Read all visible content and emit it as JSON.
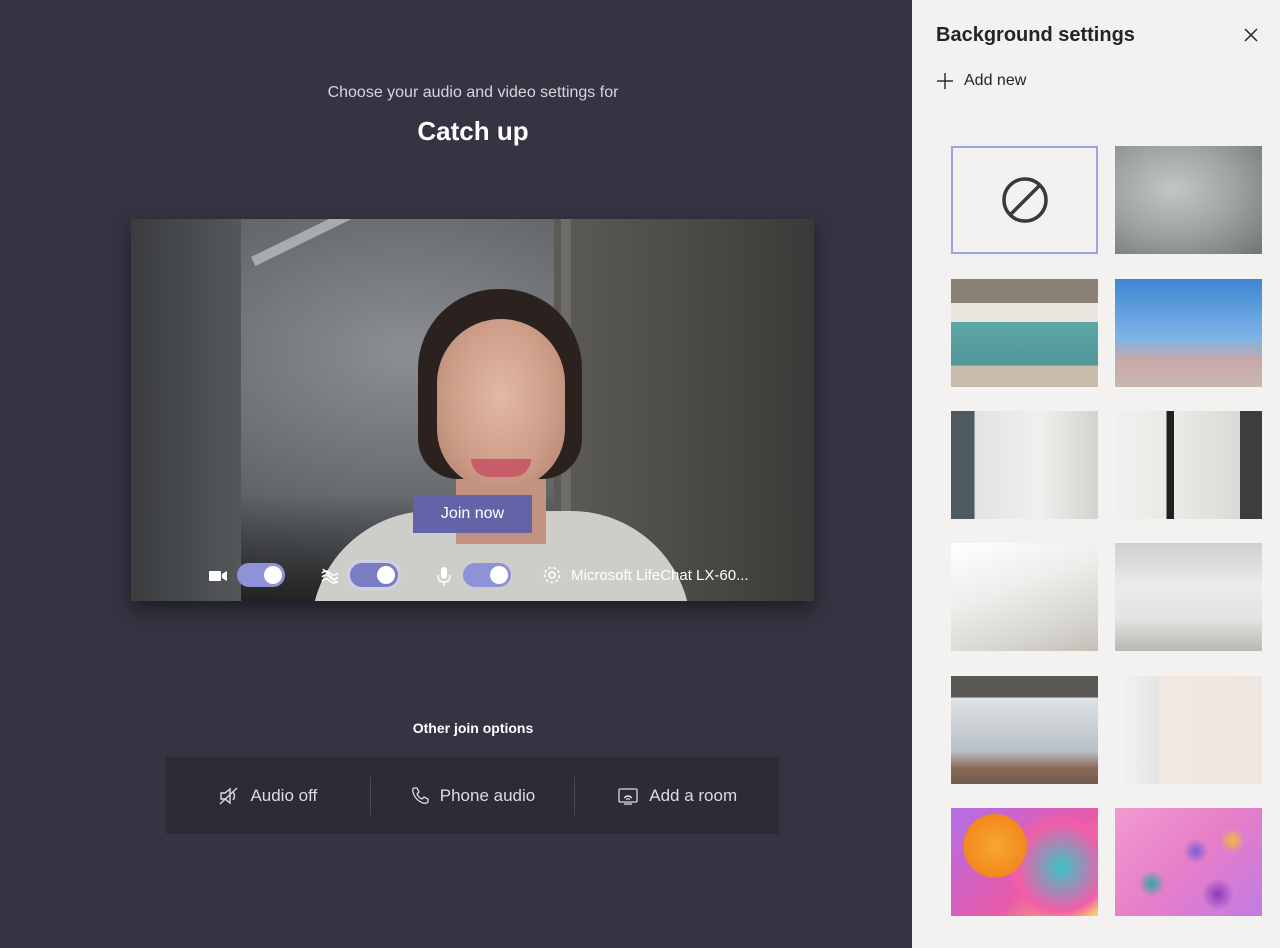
{
  "header": {
    "subtitle": "Choose your audio and video settings for",
    "meeting_title": "Catch up"
  },
  "preview": {
    "join_label": "Join now",
    "camera_on": true,
    "blur_on": true,
    "mic_on": true,
    "device_name": "Microsoft LifeChat LX-60..."
  },
  "other_join": {
    "label": "Other join options",
    "options": [
      {
        "label": "Audio off",
        "icon": "speaker-off-icon"
      },
      {
        "label": "Phone audio",
        "icon": "phone-icon"
      },
      {
        "label": "Add a room",
        "icon": "room-cast-icon"
      }
    ]
  },
  "panel": {
    "title": "Background settings",
    "add_new_label": "Add new",
    "backgrounds": [
      {
        "name": "none",
        "selected": true
      },
      {
        "name": "blur"
      },
      {
        "name": "office"
      },
      {
        "name": "beach"
      },
      {
        "name": "room-1"
      },
      {
        "name": "room-2"
      },
      {
        "name": "room-3"
      },
      {
        "name": "room-4"
      },
      {
        "name": "loft"
      },
      {
        "name": "room-5"
      },
      {
        "name": "balloons-1"
      },
      {
        "name": "balloons-2"
      }
    ]
  },
  "colors": {
    "accent": "#6264a7",
    "toggle_on": "#8f92d6",
    "main_bg": "#353442",
    "panel_bg": "#f3f2f1"
  }
}
